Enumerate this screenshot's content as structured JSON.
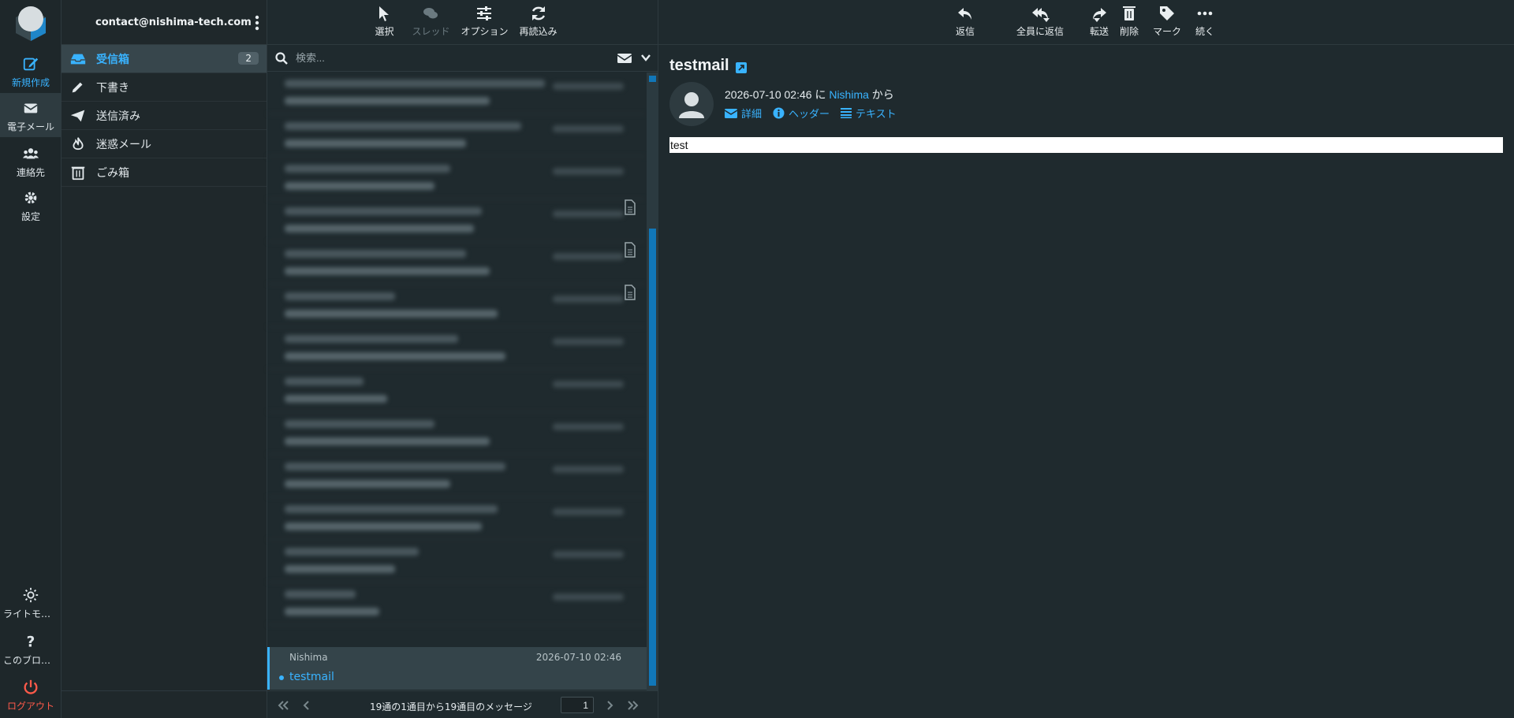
{
  "rail": {
    "items": [
      {
        "label": "新規作成"
      },
      {
        "label": "電子メール"
      },
      {
        "label": "連絡先"
      },
      {
        "label": "設定"
      },
      {
        "label": "ライトモー..."
      },
      {
        "label": "このブログ..."
      },
      {
        "label": "ログアウト"
      }
    ]
  },
  "account": {
    "email": "contact@nishima-tech.com"
  },
  "folders": [
    {
      "label": "受信箱",
      "badge": "2"
    },
    {
      "label": "下書き"
    },
    {
      "label": "送信済み"
    },
    {
      "label": "迷惑メール"
    },
    {
      "label": "ごみ箱"
    }
  ],
  "list_toolbar": {
    "select": "選択",
    "thread": "スレッド",
    "options": "オプション",
    "reload": "再読込み"
  },
  "search": {
    "placeholder": "検索..."
  },
  "selected_message": {
    "from": "Nishima",
    "date": "2026-07-10 02:46",
    "subject": "testmail"
  },
  "pager": {
    "info": "19通の1通目から19通目のメッセージ",
    "page": "1"
  },
  "reader_toolbar": {
    "reply": "返信",
    "reply_all": "全員に返信",
    "forward": "転送",
    "delete": "削除",
    "mark": "マーク",
    "more": "続く"
  },
  "message": {
    "subject": "testmail",
    "date": "2026-07-10 02:46",
    "on": "に",
    "sender": "Nishima",
    "from_suffix": "から",
    "links": {
      "details": "詳細",
      "headers": "ヘッダー",
      "plain": "テキスト"
    },
    "body": "test"
  },
  "colors": {
    "accent": "#39b3ff",
    "logout": "#ff5a4a",
    "background": "#1f2a2e"
  }
}
